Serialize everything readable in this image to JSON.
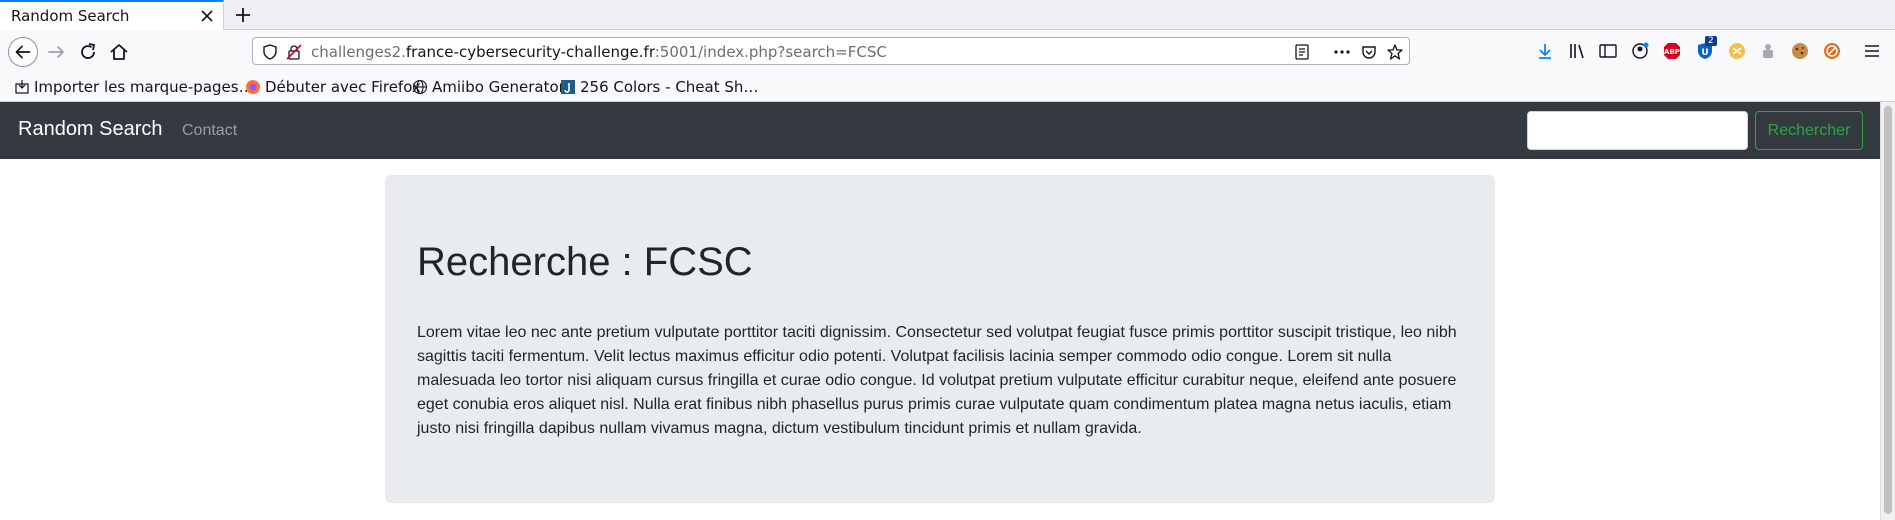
{
  "browser": {
    "tab": {
      "title": "Random Search"
    },
    "url": {
      "prefix": "challenges2.",
      "host": "france-cybersecurity-challenge.fr",
      "suffix": ":5001/index.php?search=FCSC"
    },
    "bookmarks": [
      {
        "label": "Importer les marque-pages…",
        "icon": "import-icon"
      },
      {
        "label": "Débuter avec Firefox",
        "icon": "firefox-icon"
      },
      {
        "label": "Amiibo Generator",
        "icon": "globe-icon"
      },
      {
        "label": "256 Colors - Cheat Sh…",
        "icon": "bookmark-favicon"
      }
    ],
    "extension_badge": "2"
  },
  "page": {
    "navbar": {
      "brand": "Random Search",
      "links": [
        "Contact"
      ],
      "search_value": "",
      "search_button": "Rechercher"
    },
    "jumbotron": {
      "title": "Recherche : FCSC",
      "text": "Lorem vitae leo nec ante pretium vulputate porttitor taciti dignissim. Consectetur sed volutpat feugiat fusce primis porttitor suscipit tristique, leo nibh sagittis taciti fermentum. Velit lectus maximus efficitur odio potenti. Volutpat facilisis lacinia semper commodo odio congue. Lorem sit nulla malesuada leo tortor nisi aliquam cursus fringilla et curae odio congue. Id volutpat pretium vulputate efficitur curabitur neque, eleifend ante posuere eget conubia eros aliquet nisl. Nulla erat finibus nibh phasellus purus primis curae vulputate quam condimentum platea magna netus iaculis, etiam justo nisi fringilla dapibus nullam vivamus magna, dictum vestibulum tincidunt primis et nullam gravida."
    }
  },
  "colors": {
    "navbar_bg": "#343a40",
    "jumbotron_bg": "#e9ecef",
    "success": "#28a745",
    "firefox_accent": "#0a84ff"
  }
}
